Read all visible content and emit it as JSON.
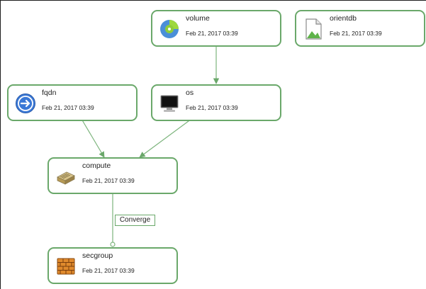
{
  "nodes": {
    "volume": {
      "name": "volume",
      "date": "Feb 21, 2017 03:39",
      "icon": "volume-disk-icon"
    },
    "orientdb": {
      "name": "orientdb",
      "date": "Feb 21, 2017 03:39",
      "icon": "document-image-icon"
    },
    "fqdn": {
      "name": "fqdn",
      "date": "Feb 21, 2017 03:39",
      "icon": "arrow-circle-icon"
    },
    "os": {
      "name": "os",
      "date": "Feb 21, 2017 03:39",
      "icon": "monitor-icon"
    },
    "compute": {
      "name": "compute",
      "date": "Feb 21, 2017 03:39",
      "icon": "server-icon"
    },
    "secgroup": {
      "name": "secgroup",
      "date": "Feb 21, 2017 03:39",
      "icon": "firewall-icon"
    }
  },
  "edge_label": "Converge",
  "colors": {
    "node_border": "#6aa86a",
    "edge": "#7cb47c"
  }
}
